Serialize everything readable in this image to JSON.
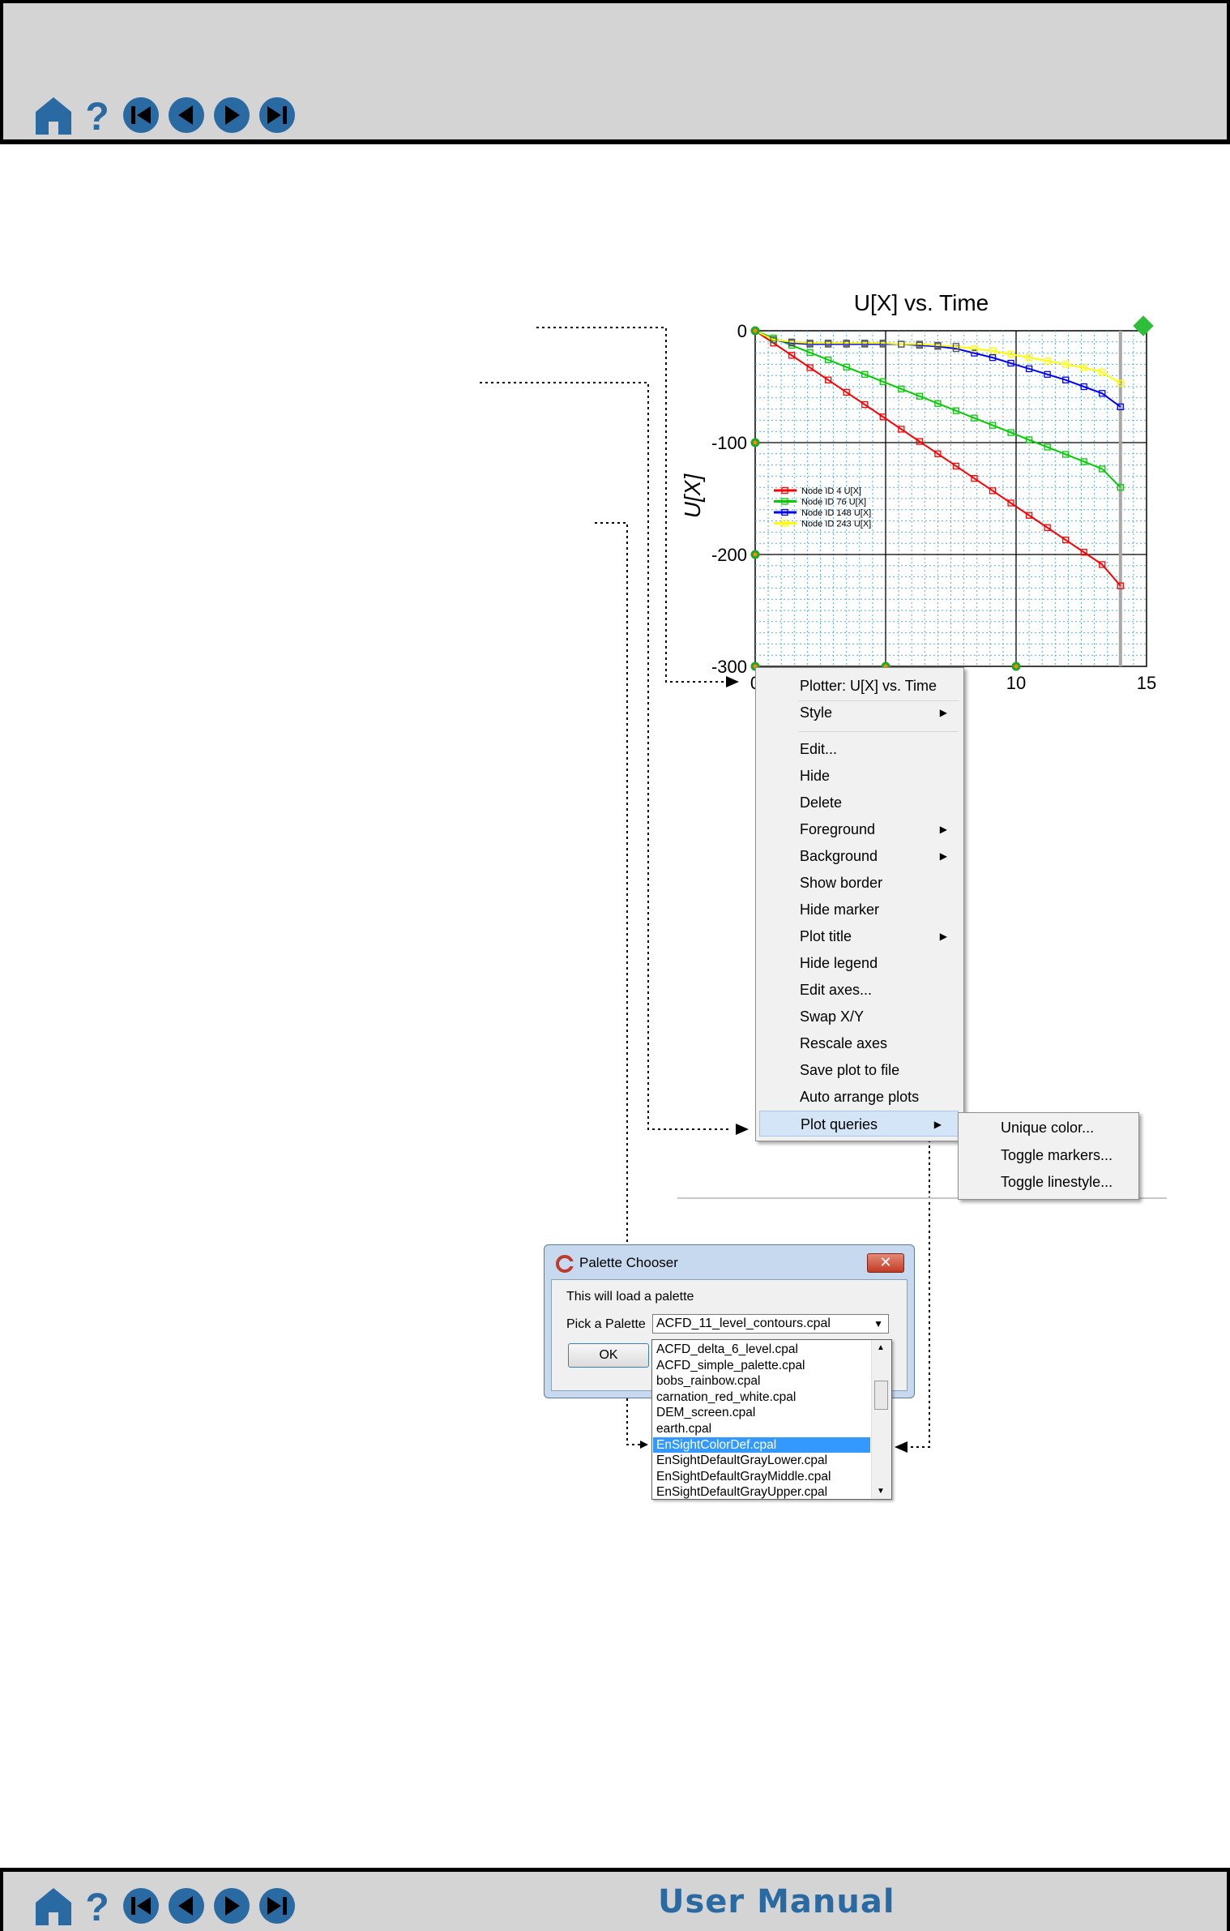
{
  "manual_title": "User Manual",
  "colors": {
    "nav_blue": "#2a6aa2",
    "bar_grey": "#d4d4d4"
  },
  "icons": [
    "home-icon",
    "help-icon",
    "first-page-icon",
    "previous-page-icon",
    "next-page-icon",
    "last-page-icon"
  ],
  "chart_data": {
    "type": "line",
    "title": "U[X] vs. Time",
    "ylabel": "U[X]",
    "xlabel": "",
    "xlim": [
      0,
      15
    ],
    "ylim": [
      -300,
      0
    ],
    "x_ticks": [
      "0",
      "10",
      "15"
    ],
    "y_ticks": [
      "0",
      "-100",
      "-200",
      "-300"
    ],
    "grid": true,
    "legend_position": "left",
    "x": [
      0,
      0.7,
      1.4,
      2.1,
      2.8,
      3.5,
      4.2,
      4.9,
      5.6,
      6.3,
      7.0,
      7.7,
      8.4,
      9.1,
      9.8,
      10.5,
      11.2,
      11.9,
      12.6,
      13.3,
      14.0
    ],
    "series": [
      {
        "name": "Node ID 4 U[X]",
        "color": "#ff0000",
        "values": [
          0,
          -11,
          -22,
          -33,
          -44,
          -55,
          -66,
          -77,
          -88,
          -99,
          -110,
          -121,
          -132,
          -143,
          -154,
          -165,
          -176,
          -187,
          -198,
          -209,
          -228
        ]
      },
      {
        "name": "Node ID 76 U[X]",
        "color": "#00cc00",
        "values": [
          0,
          -6.5,
          -13,
          -19.5,
          -26,
          -32.5,
          -39,
          -45.5,
          -52,
          -58.5,
          -65,
          -71.5,
          -78,
          -84.5,
          -91,
          -97.5,
          -104,
          -110.5,
          -117,
          -123.5,
          -140
        ]
      },
      {
        "name": "Node ID 148 U[X]",
        "color": "#0000ff",
        "values": [
          0,
          -8,
          -11,
          -12,
          -12,
          -12,
          -12,
          -12,
          -12,
          -13,
          -14,
          -16,
          -20,
          -24,
          -29,
          -34,
          -39,
          -44,
          -50,
          -56,
          -68
        ]
      },
      {
        "name": "Node ID 243 U[X]",
        "color": "#ffff00",
        "values": [
          0,
          -8,
          -10,
          -11,
          -11,
          -11,
          -11,
          -11,
          -12,
          -12,
          -13,
          -14,
          -16,
          -18,
          -21,
          -24,
          -27,
          -30,
          -33,
          -37,
          -47
        ]
      }
    ]
  },
  "context_menu": {
    "header": "Plotter: U[X] vs. Time",
    "items": [
      {
        "label": "Style",
        "submenu": true
      },
      {
        "label": "Edit...",
        "submenu": false
      },
      {
        "label": "Hide",
        "submenu": false
      },
      {
        "label": "Delete",
        "submenu": false
      },
      {
        "label": "Foreground",
        "submenu": true
      },
      {
        "label": "Background",
        "submenu": true
      },
      {
        "label": "Show border",
        "submenu": false
      },
      {
        "label": "Hide marker",
        "submenu": false
      },
      {
        "label": "Plot title",
        "submenu": true
      },
      {
        "label": "Hide legend",
        "submenu": false
      },
      {
        "label": "Edit axes...",
        "submenu": false
      },
      {
        "label": "Swap X/Y",
        "submenu": false
      },
      {
        "label": "Rescale axes",
        "submenu": false
      },
      {
        "label": "Save plot to file",
        "submenu": false
      },
      {
        "label": "Auto arrange plots",
        "submenu": false
      },
      {
        "label": "Plot queries",
        "submenu": true
      }
    ],
    "highlighted": "Plot queries"
  },
  "submenu": {
    "items": [
      "Unique color...",
      "Toggle markers...",
      "Toggle linestyle..."
    ]
  },
  "palette_dialog": {
    "title": "Palette Chooser",
    "message": "This will load a palette",
    "pick_label": "Pick a Palette",
    "selected_value": "ACFD_11_level_contours.cpal",
    "ok_label": "OK",
    "close_symbol": "✕",
    "options": [
      "ACFD_delta_6_level.cpal",
      "ACFD_simple_palette.cpal",
      "bobs_rainbow.cpal",
      "carnation_red_white.cpal",
      "DEM_screen.cpal",
      "earth.cpal",
      "EnSightColorDef.cpal",
      "EnSightDefaultGrayLower.cpal",
      "EnSightDefaultGrayMiddle.cpal",
      "EnSightDefaultGrayUpper.cpal"
    ],
    "highlighted_option": "EnSightColorDef.cpal"
  }
}
